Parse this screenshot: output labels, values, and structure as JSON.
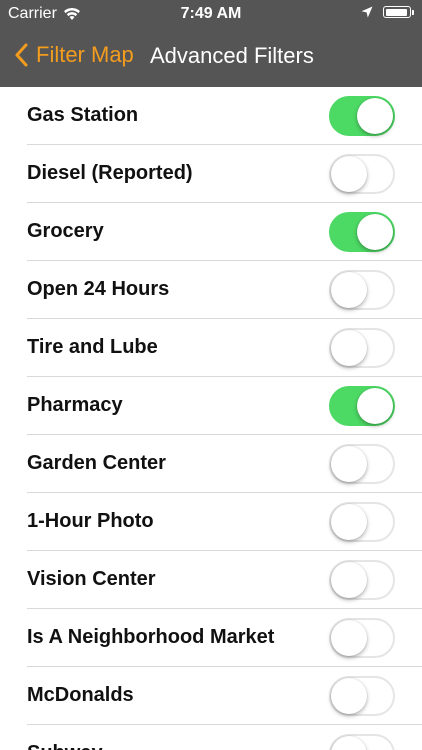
{
  "status_bar": {
    "carrier": "Carrier",
    "time": "7:49 AM",
    "battery_level": 0.95
  },
  "nav": {
    "back_label": "Filter Map",
    "title": "Advanced Filters",
    "accent_color": "#f39c1d",
    "bar_color": "#555555"
  },
  "filters": [
    {
      "label": "Gas Station",
      "enabled": true
    },
    {
      "label": "Diesel (Reported)",
      "enabled": false
    },
    {
      "label": "Grocery",
      "enabled": true
    },
    {
      "label": "Open 24 Hours",
      "enabled": false
    },
    {
      "label": "Tire and Lube",
      "enabled": false
    },
    {
      "label": "Pharmacy",
      "enabled": true
    },
    {
      "label": "Garden Center",
      "enabled": false
    },
    {
      "label": "1-Hour Photo",
      "enabled": false
    },
    {
      "label": "Vision Center",
      "enabled": false
    },
    {
      "label": "Is A Neighborhood Market",
      "enabled": false
    },
    {
      "label": "McDonalds",
      "enabled": false
    },
    {
      "label": "Subway",
      "enabled": false
    }
  ],
  "toggle_on_color": "#4cd964"
}
